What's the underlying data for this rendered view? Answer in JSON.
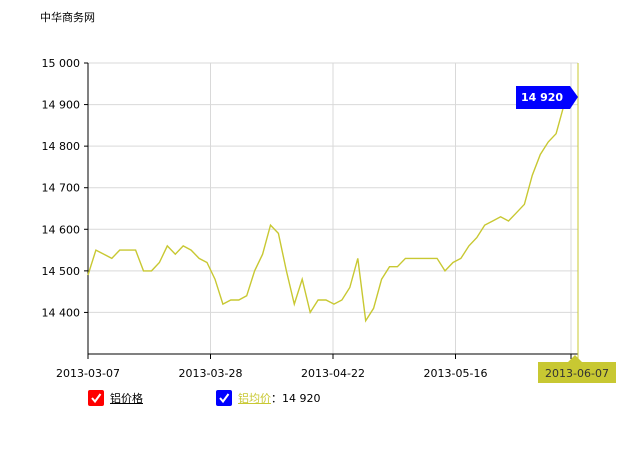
{
  "page": {
    "brand": "中华商务网"
  },
  "colors": {
    "line": "#c8c832",
    "tooltip_bg": "#0000ff",
    "date_badge_bg": "#c8c832",
    "legend_red": "#ff0000",
    "legend_blue": "#0000ff"
  },
  "legend": {
    "items": [
      {
        "label": "铝价格",
        "color_key": "legend_red",
        "text_color": "#000000",
        "value": ""
      },
      {
        "label": "铝均价",
        "color_key": "legend_blue",
        "text_color": "#c8c832",
        "value": "：14 920"
      }
    ]
  },
  "chart_data": {
    "type": "line",
    "title": "",
    "xlabel": "",
    "ylabel": "",
    "ylim": [
      14300,
      15000
    ],
    "yticks": [
      "15 000",
      "14 900",
      "14 800",
      "14 700",
      "14 600",
      "14 500",
      "14 400"
    ],
    "ytick_values": [
      15000,
      14900,
      14800,
      14700,
      14600,
      14500,
      14400
    ],
    "xtick_labels": [
      "2013-03-07",
      "2013-03-28",
      "2013-04-22",
      "2013-05-16",
      "2013-06-07"
    ],
    "grid": true,
    "tooltip_value": "14 920",
    "highlight_date": "2013-06-07",
    "series": [
      {
        "name": "铝均价",
        "values": [
          14490,
          14550,
          14540,
          14530,
          14550,
          14550,
          14550,
          14500,
          14500,
          14520,
          14560,
          14540,
          14560,
          14550,
          14530,
          14520,
          14480,
          14420,
          14430,
          14430,
          14440,
          14500,
          14540,
          14610,
          14590,
          14500,
          14420,
          14480,
          14400,
          14430,
          14430,
          14420,
          14430,
          14460,
          14530,
          14380,
          14410,
          14480,
          14510,
          14510,
          14530,
          14530,
          14530,
          14530,
          14530,
          14500,
          14520,
          14530,
          14560,
          14580,
          14610,
          14620,
          14630,
          14620,
          14640,
          14660,
          14730,
          14780,
          14810,
          14830,
          14900,
          14920
        ]
      }
    ]
  }
}
